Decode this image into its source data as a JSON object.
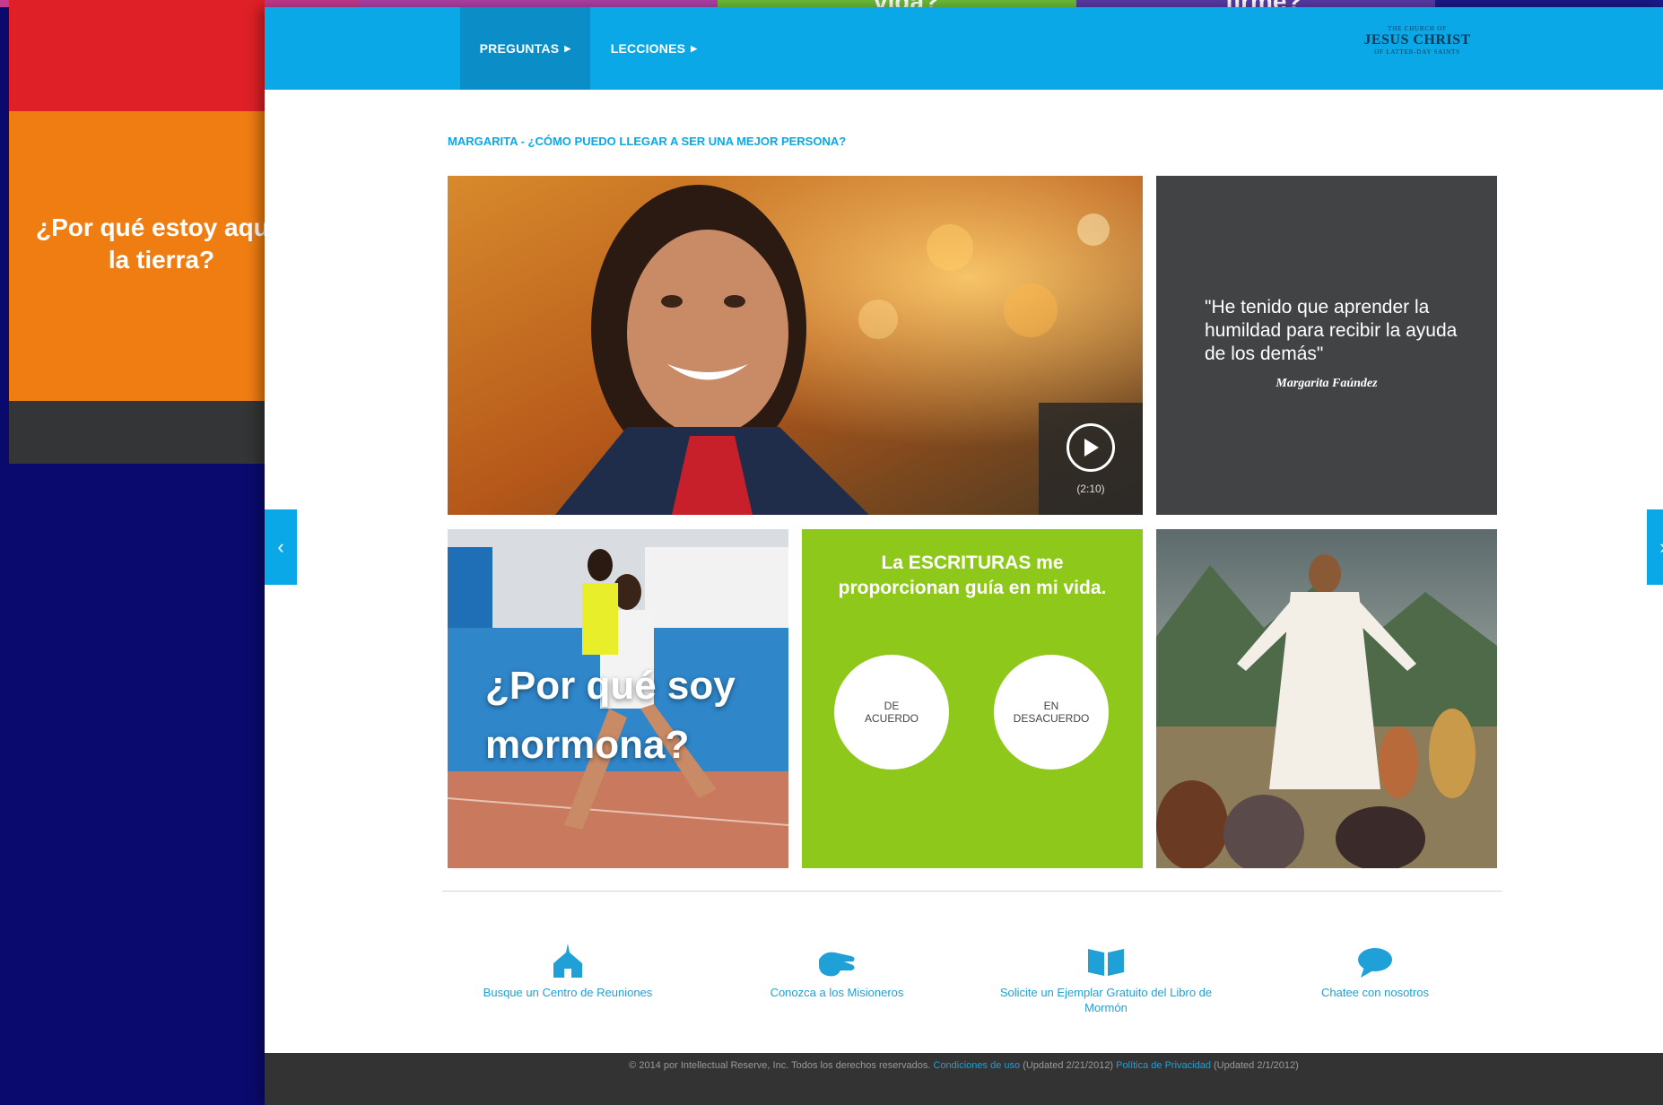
{
  "background": {
    "strip_texts": [
      "vida?",
      "firme?"
    ],
    "tile_question_line1": "¿Por qué estoy aquí en",
    "tile_question_line2": "la tierra?"
  },
  "nav": {
    "items": [
      {
        "label": "PREGUNTAS"
      },
      {
        "label": "LECCIONES"
      }
    ],
    "logo_small_top": "THE CHURCH OF",
    "logo_main": "JESUS CHRIST",
    "logo_small_bottom": "OF LATTER-DAY SAINTS"
  },
  "breadcrumb": "MARGARITA - ¿CÓMO PUEDO LLEGAR A SER UNA MEJOR PERSONA?",
  "video": {
    "duration": "(2:10)"
  },
  "quote": {
    "text": "\"He tenido que aprender la humildad para recibir la ayuda de los demás\"",
    "author": "Margarita Faúndez"
  },
  "runner": {
    "title": "¿Por qué soy mormona?"
  },
  "poll": {
    "question": "La ESCRITURAS me proporcionan guía en mi vida.",
    "agree": "DE\nACUERDO",
    "disagree": "EN\nDESACUERDO"
  },
  "actions": [
    {
      "label": "Busque un Centro de Reuniones",
      "icon": "church-icon"
    },
    {
      "label": "Conozca a los Misioneros",
      "icon": "hand-icon"
    },
    {
      "label": "Solicite un Ejemplar Gratuito del Libro de Mormón",
      "icon": "book-icon"
    },
    {
      "label": "Chatee con nosotros",
      "icon": "chat-icon"
    }
  ],
  "footer": {
    "copyright": "© 2014 por Intellectual Reserve, Inc. Todos los derechos reservados.",
    "terms_link": "Condiciones de uso",
    "terms_updated": "(Updated 2/21/2012)",
    "privacy_link": "Política de Privacidad",
    "privacy_updated": "(Updated 2/1/2012)"
  },
  "colors": {
    "header_blue": "#0aa8e6",
    "poll_green": "#8ec81a",
    "quote_gray": "#424345",
    "bg_navy": "#0a0a6e"
  }
}
